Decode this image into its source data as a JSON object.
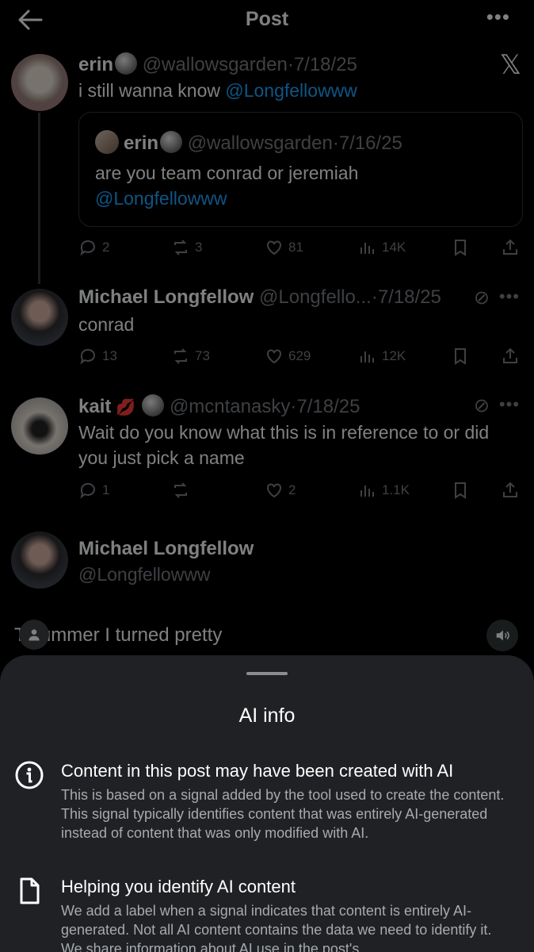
{
  "header": {
    "title": "Post"
  },
  "posts": [
    {
      "name": "erin",
      "handle": "@wallowsgarden",
      "date": "7/18/25",
      "text": "i still wanna know ",
      "mention": "@Longfellowww",
      "quote": {
        "name": "erin",
        "handle": "@wallowsgarden",
        "date": "7/16/25",
        "text": "are you team conrad or jeremiah",
        "mention": "@Longfellowww"
      },
      "stats": {
        "replies": "2",
        "reposts": "3",
        "likes": "81",
        "views": "14K"
      }
    },
    {
      "name": "Michael Longfellow",
      "handle": "@Longfello...",
      "date": "7/18/25",
      "text": "conrad",
      "stats": {
        "replies": "13",
        "reposts": "73",
        "likes": "629",
        "views": "12K"
      }
    },
    {
      "name": "kait",
      "handle": "@mcntanasky",
      "date": "7/18/25",
      "text": "Wait do you know what this is in reference to or did you just pick a name",
      "stats": {
        "replies": "1",
        "reposts": "",
        "likes": "2",
        "views": "1.1K"
      }
    }
  ],
  "profile_card": {
    "name": "Michael Longfellow",
    "handle": "@Longfellowww"
  },
  "caption": {
    "text": "T   summer I turned pretty"
  },
  "sheet": {
    "title": "AI info",
    "items": [
      {
        "icon": "info-icon",
        "heading": "Content in this post may have been created with AI",
        "text": "This is based on a signal added by the tool used to create the content. This signal typically identifies content that was entirely AI-generated instead of content that was only modified with AI."
      },
      {
        "icon": "document-icon",
        "heading": "Helping you identify AI content",
        "text": "We add a label when a signal indicates that content is entirely AI-generated. Not all AI content contains the data we need to identify it. We share information about AI use in the post's"
      }
    ]
  },
  "colors": {
    "accent": "#1d9bf0",
    "muted": "#71767b",
    "sheet_bg": "#1f2124"
  }
}
